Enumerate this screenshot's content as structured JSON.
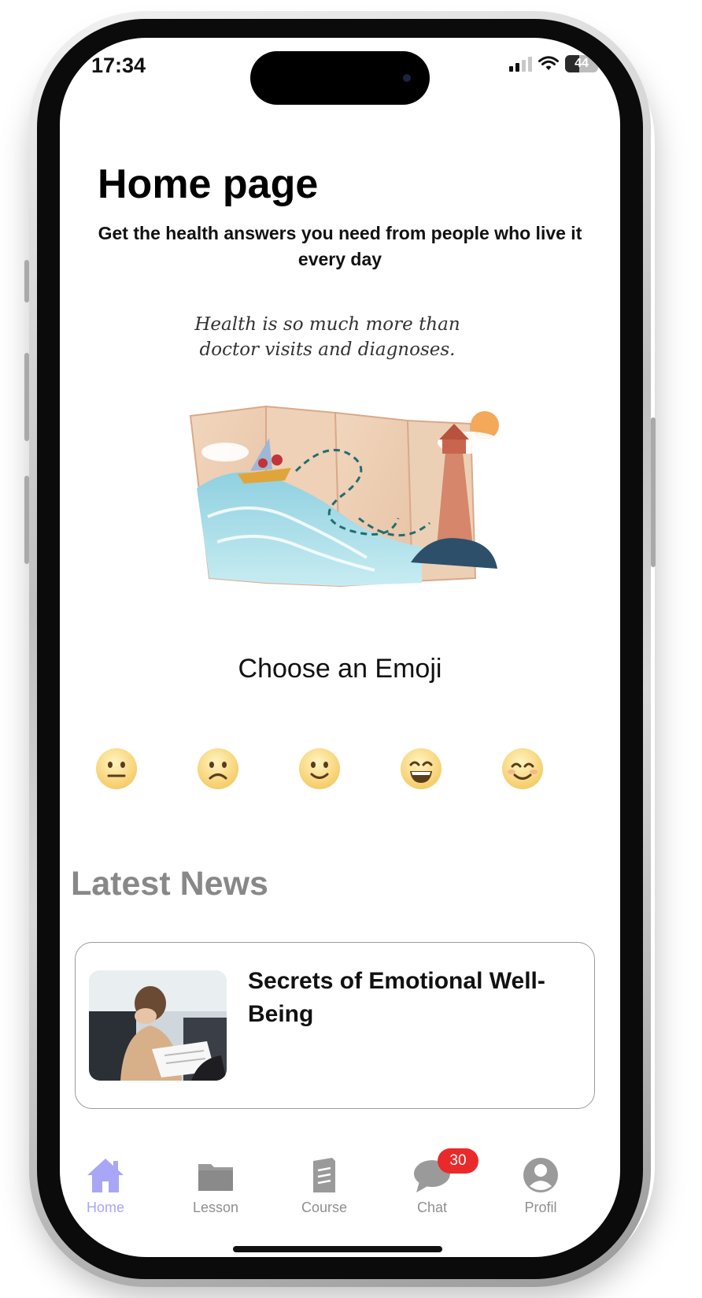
{
  "status_bar": {
    "time": "17:34",
    "battery": "44",
    "battery_level": 0.44,
    "signal_bars_active": 2,
    "icons": [
      "cellular-signal-icon",
      "wifi-icon",
      "battery-icon"
    ]
  },
  "header": {
    "title": "Home page",
    "subtitle": "Get the health answers you need from people who live it every day"
  },
  "hero": {
    "quote_line1": "Health is so much more than",
    "quote_line2": "doctor visits and diagnoses.",
    "illustration": "map-with-boat-and-lighthouse"
  },
  "emoji_picker": {
    "heading": "Choose an Emoji",
    "options": [
      "neutral-face",
      "slightly-frowning-face",
      "slightly-smiling-face",
      "grinning-face",
      "smiling-face-with-smiling-eyes"
    ]
  },
  "latest_news": {
    "heading": "Latest News",
    "articles": [
      {
        "title": "Secrets of Emotional Well-Being",
        "thumbnail": "stressed-woman-photo"
      }
    ]
  },
  "tab_bar": {
    "active": "Home",
    "active_color": "#a9a6f6",
    "inactive_color": "#8f8f8f",
    "items": [
      {
        "label": "Home",
        "icon": "home-icon"
      },
      {
        "label": "Lesson",
        "icon": "folder-icon"
      },
      {
        "label": "Course",
        "icon": "book-icon"
      },
      {
        "label": "Chat",
        "icon": "chat-bubble-icon",
        "badge": "30"
      },
      {
        "label": "Profil",
        "icon": "profile-icon"
      }
    ]
  }
}
